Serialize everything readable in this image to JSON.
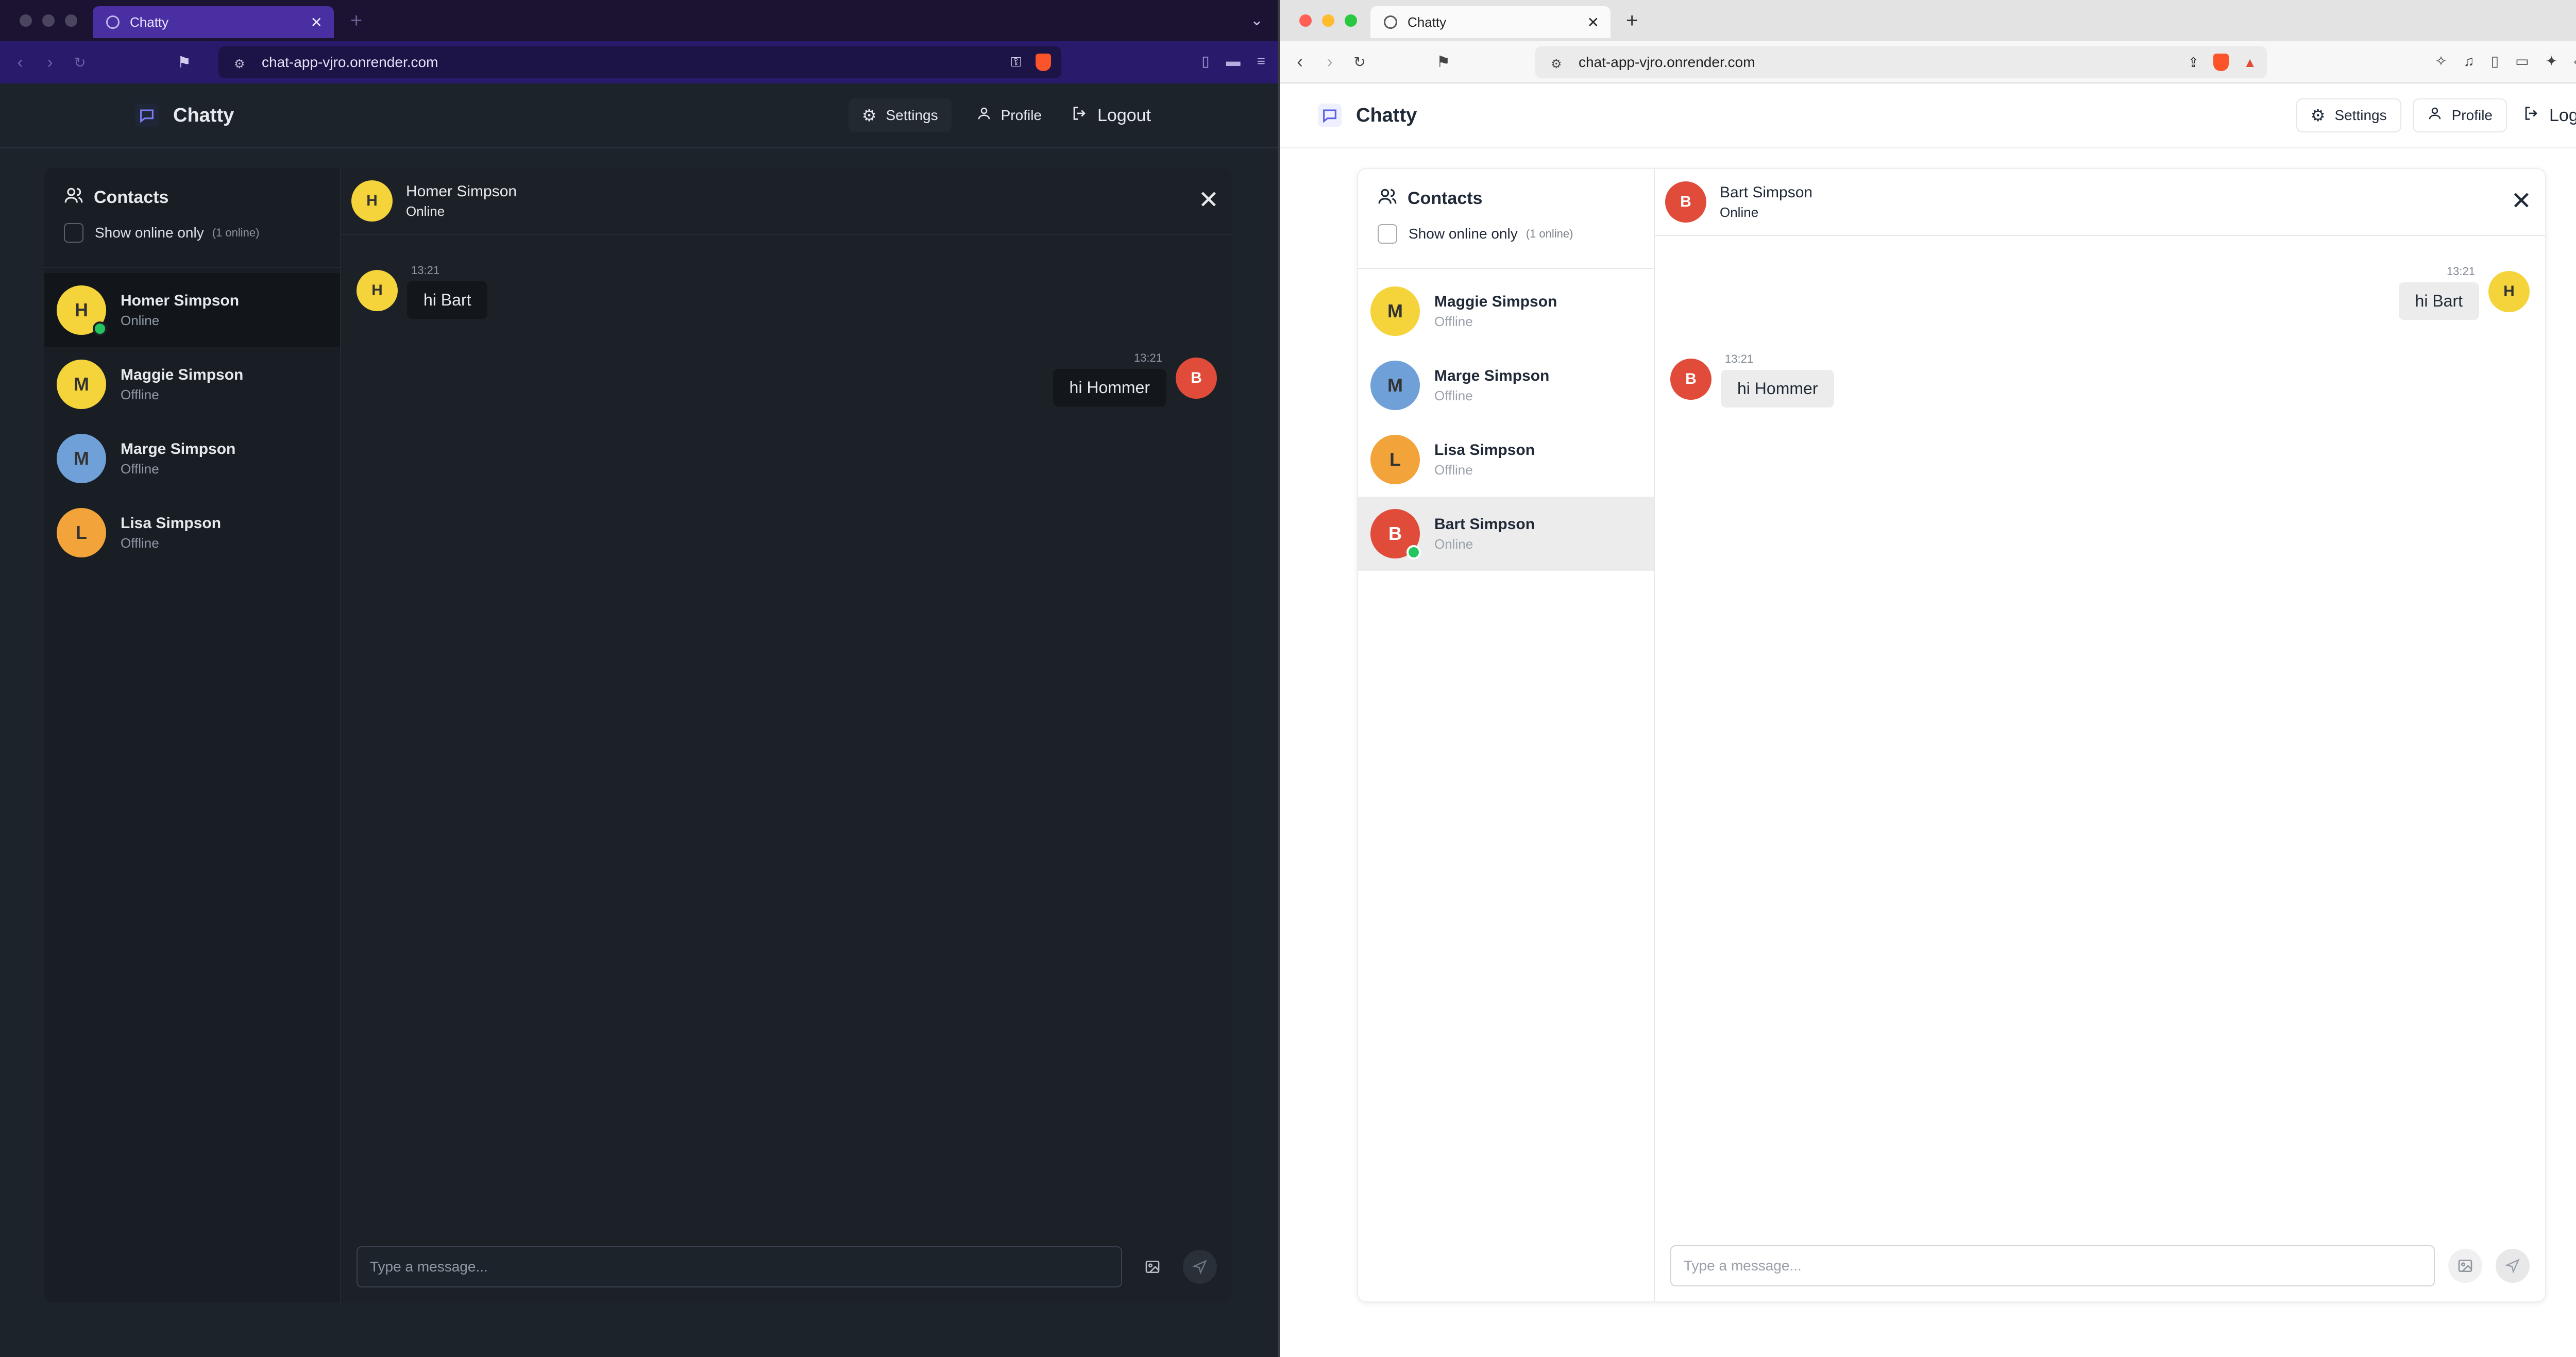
{
  "left_window": {
    "tab_title": "Chatty",
    "url": "chat-app-vjro.onrender.com",
    "app": {
      "brand": "Chatty",
      "nav": {
        "settings": "Settings",
        "profile": "Profile",
        "logout": "Logout"
      },
      "contacts": {
        "title": "Contacts",
        "filter_label": "Show online only",
        "online_count": "(1 online)",
        "items": [
          {
            "name": "Homer Simpson",
            "status": "Online",
            "initial": "H",
            "color": "#f5d33a"
          },
          {
            "name": "Maggie Simpson",
            "status": "Offline",
            "initial": "M",
            "color": "#f5d33a"
          },
          {
            "name": "Marge Simpson",
            "status": "Offline",
            "initial": "M",
            "color": "#6fa0d8"
          },
          {
            "name": "Lisa Simpson",
            "status": "Offline",
            "initial": "L",
            "color": "#f2a33a"
          }
        ]
      },
      "chat": {
        "name": "Homer Simpson",
        "status": "Online",
        "messages": [
          {
            "time": "13:21",
            "text": "hi Bart",
            "side": "left"
          },
          {
            "time": "13:21",
            "text": "hi Hommer",
            "side": "right"
          }
        ],
        "placeholder": "Type a message..."
      }
    }
  },
  "right_window": {
    "tab_title": "Chatty",
    "url": "chat-app-vjro.onrender.com",
    "app": {
      "brand": "Chatty",
      "nav": {
        "settings": "Settings",
        "profile": "Profile",
        "logout": "Logout"
      },
      "contacts": {
        "title": "Contacts",
        "filter_label": "Show online only",
        "online_count": "(1 online)",
        "items": [
          {
            "name": "Maggie Simpson",
            "status": "Offline",
            "initial": "M",
            "color": "#f5d33a"
          },
          {
            "name": "Marge Simpson",
            "status": "Offline",
            "initial": "M",
            "color": "#6fa0d8"
          },
          {
            "name": "Lisa Simpson",
            "status": "Offline",
            "initial": "L",
            "color": "#f2a33a"
          },
          {
            "name": "Bart Simpson",
            "status": "Online",
            "initial": "B",
            "color": "#e04b3a"
          }
        ]
      },
      "chat": {
        "name": "Bart Simpson",
        "status": "Online",
        "messages": [
          {
            "time": "13:21",
            "text": "hi Bart",
            "side": "right"
          },
          {
            "time": "13:21",
            "text": "hi Hommer",
            "side": "left"
          }
        ],
        "placeholder": "Type a message..."
      }
    }
  },
  "icons": {
    "back": "back-arrow-icon",
    "forward": "forward-arrow-icon",
    "reload": "reload-icon",
    "bookmark": "bookmark-icon",
    "settings": "gear-icon",
    "profile": "user-icon",
    "logout": "logout-icon",
    "contacts": "users-icon",
    "close": "close-icon",
    "image": "image-icon",
    "send": "send-icon"
  }
}
